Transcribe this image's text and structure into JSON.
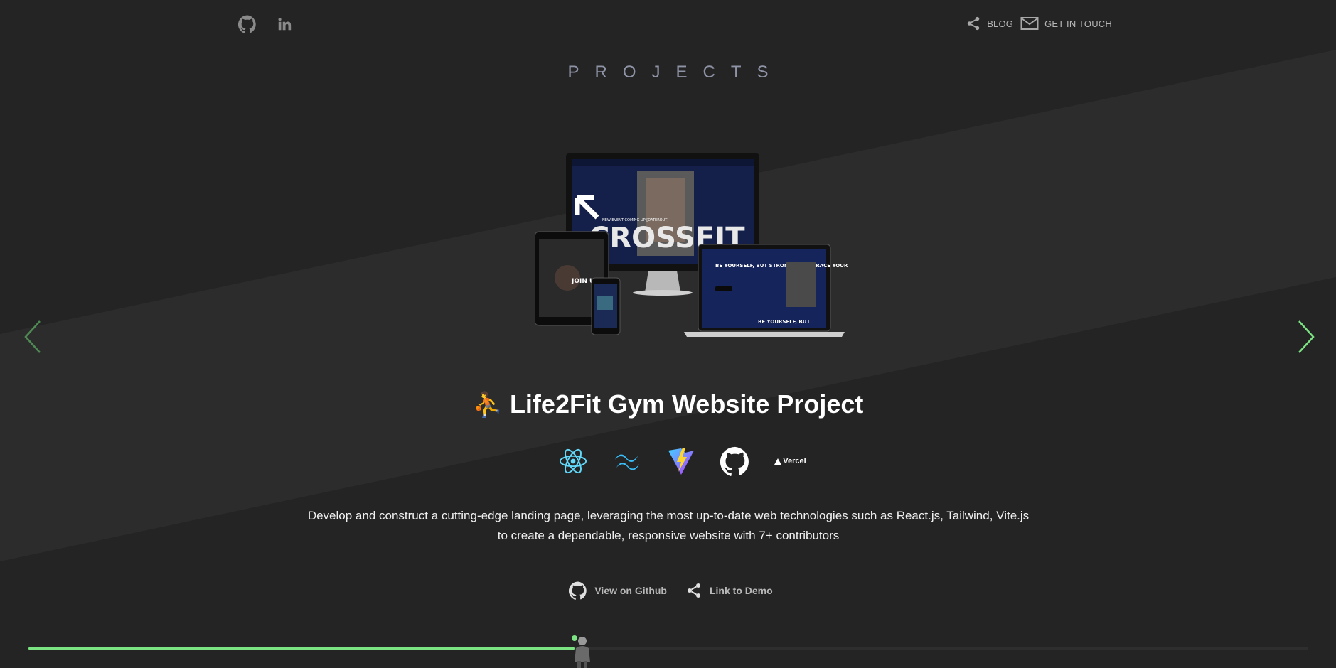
{
  "header": {
    "social": [
      {
        "icon": "github-icon",
        "label": "GitHub"
      },
      {
        "icon": "linkedin-icon",
        "label": "LinkedIn"
      }
    ],
    "nav": {
      "blog_label": "BLOG",
      "contact_label": "GET IN TOUCH"
    }
  },
  "section": {
    "title": "PROJECTS"
  },
  "project": {
    "emoji": "⛹️",
    "title": "Life2Fit Gym Website Project",
    "techs": [
      "react-icon",
      "tailwind-icon",
      "vite-icon",
      "github-icon",
      "vercel-logo"
    ],
    "vercel_label": "Vercel",
    "description_line1": "Develop and construct a cutting-edge landing page, leveraging the most up-to-date web technologies such as React.js, Tailwind, Vite.js",
    "description_line2": "to create a dependable, responsive website with 7+ contributors",
    "mockup": {
      "headline": "CROSSFIT",
      "event_text": "NEW EVENT COMING UP [DATEROUT]",
      "join_text": "JOIN US",
      "laptop_text1": "BE YOURSELF, BUT STRONGER! EMBRACE YOUR POWER",
      "laptop_text2": "BE YOURSELF, BUT"
    },
    "links": {
      "github_label": "View on Github",
      "demo_label": "Link to Demo"
    }
  },
  "carousel": {
    "progress": 0.4265
  },
  "colors": {
    "accent": "#7be382",
    "background": "#242424",
    "band": "#2b2b2b",
    "title": "#8f93a6"
  }
}
